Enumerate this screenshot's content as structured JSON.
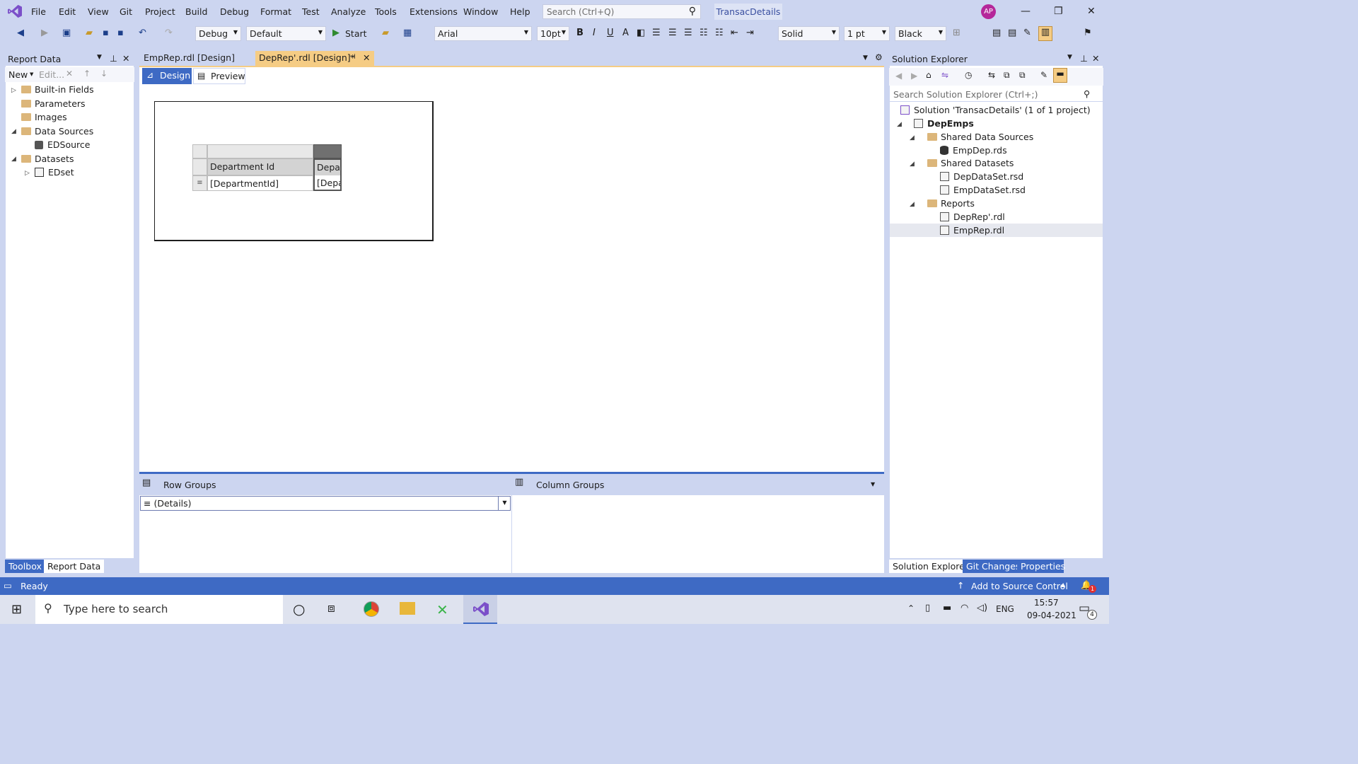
{
  "app": {
    "menu": [
      "File",
      "Edit",
      "View",
      "Git",
      "Project",
      "Build",
      "Debug",
      "Format",
      "Test",
      "Analyze",
      "Tools",
      "Extensions",
      "Window",
      "Help"
    ],
    "search_placeholder": "Search (Ctrl+Q)",
    "solution_name": "TransacDetails",
    "avatar_initials": "AP"
  },
  "toolbar": {
    "config": "Debug",
    "platform": "Default",
    "start_label": "Start",
    "font": "Arial",
    "font_size": "10pt",
    "bold": "B",
    "italic": "I",
    "underline": "U",
    "border_style": "Solid",
    "border_width": "1 pt",
    "border_color": "Black"
  },
  "report_data": {
    "title": "Report Data",
    "new_label": "New",
    "edit_label": "Edit...",
    "items": [
      {
        "label": "Built-in Fields"
      },
      {
        "label": "Parameters"
      },
      {
        "label": "Images"
      },
      {
        "label": "Data Sources"
      },
      {
        "label": "EDSource"
      },
      {
        "label": "Datasets"
      },
      {
        "label": "EDset"
      }
    ]
  },
  "tabs": {
    "emprep": "EmpRep.rdl [Design]",
    "deprep": "DepRep'.rdl [Design]*",
    "design": "Design",
    "preview": "Preview"
  },
  "tablix": {
    "header1": "Department Id",
    "header2": "Depa",
    "value1": "[DepartmentId]",
    "value2": "[Depa"
  },
  "groups": {
    "row_groups": "Row Groups",
    "column_groups": "Column Groups",
    "details": "≡ (Details)"
  },
  "solution_explorer": {
    "title": "Solution Explorer",
    "search_placeholder": "Search Solution Explorer (Ctrl+;)",
    "solution": "Solution 'TransacDetails' (1 of 1 project)",
    "project": "DepEmps",
    "items": [
      {
        "label": "Shared Data Sources"
      },
      {
        "label": "EmpDep.rds"
      },
      {
        "label": "Shared Datasets"
      },
      {
        "label": "DepDataSet.rsd"
      },
      {
        "label": "EmpDataSet.rsd"
      },
      {
        "label": "Reports"
      },
      {
        "label": "DepRep'.rdl"
      },
      {
        "label": "EmpRep.rdl"
      }
    ]
  },
  "bottom_tabs": {
    "toolbox": "Toolbox",
    "report_data": "Report Data",
    "solution_explorer": "Solution Explorer",
    "git_changes": "Git Changes",
    "properties": "Properties"
  },
  "status": {
    "ready": "Ready",
    "source_control": "Add to Source Control",
    "notifications": "1"
  },
  "taskbar": {
    "search_placeholder": "Type here to search",
    "language": "ENG",
    "time": "15:57",
    "date": "09-04-2021",
    "notification_count": "4"
  },
  "colors": {
    "accent": "#3e6ac4",
    "chrome": "#ccd5f0",
    "active_tab": "#f5cc84",
    "vs_purple": "#7b4fc9"
  }
}
